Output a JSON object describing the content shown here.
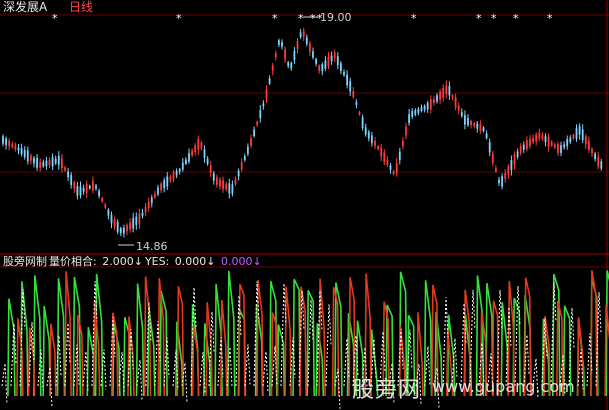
{
  "header": {
    "title": "深发展A",
    "period": "日线"
  },
  "price_panel": {
    "high_label": "19.00",
    "low_label": "14.86",
    "signal_marker": "*"
  },
  "indicator": {
    "source": "股旁网制",
    "name": "量价相合:",
    "value1": "2.000↓",
    "yes_label": "YES:",
    "value2": "0.000↓",
    "value3": "0.000↓"
  },
  "colors": {
    "background": "#000000",
    "up": "#ff3b3b",
    "down": "#7fd4ff",
    "grid": "#8b0000",
    "signal_green": "#36e03a",
    "signal_red": "#e23a1d",
    "dotted": "#ffffff",
    "purple": "#c05cff"
  },
  "watermark": {
    "brand": "股旁网",
    "url": "www.gupang.com"
  }
}
